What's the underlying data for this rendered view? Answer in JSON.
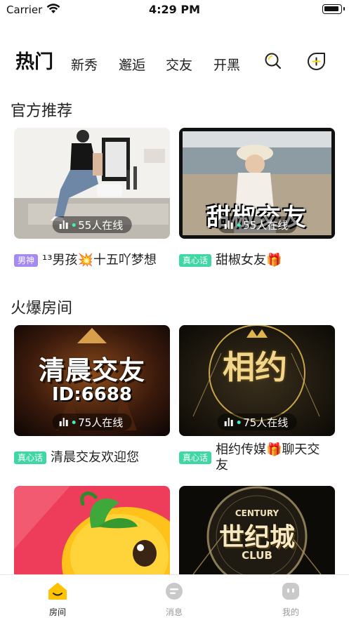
{
  "status_bar": {
    "carrier": "Carrier",
    "time": "4:29 PM"
  },
  "tabs": [
    {
      "label": "热门",
      "active": true
    },
    {
      "label": "新秀",
      "active": false
    },
    {
      "label": "邂逅",
      "active": false
    },
    {
      "label": "交友",
      "active": false
    },
    {
      "label": "开黑",
      "active": false
    }
  ],
  "header_icons": {
    "search": "search-icon",
    "create": "add-room-icon"
  },
  "sections": {
    "official": {
      "title": "官方推荐"
    },
    "hot": {
      "title": "火爆房间"
    }
  },
  "rooms": [
    {
      "online": "55人在线",
      "badge": "男神",
      "title": "¹³男孩💥十五吖梦想"
    },
    {
      "online": "55人在线",
      "badge": "真心话",
      "title": "甜椒女友🎁",
      "cover_text": "甜椒交友"
    },
    {
      "online": "75人在线",
      "badge": "真心话",
      "title": "清晨交友欢迎您",
      "cover_text": "清晨交友",
      "cover_sub": "ID:6688"
    },
    {
      "online": "75人在线",
      "badge": "真心话",
      "title": "相约传媒🎁聊天交友",
      "cover_text": "相约"
    },
    {
      "cover_text": ""
    },
    {
      "cover_text": "世纪城",
      "cover_sub": "CLUB",
      "cover_top": "CENTURY"
    }
  ],
  "bottom_nav": [
    {
      "label": "房间",
      "active": true,
      "icon": "home-icon"
    },
    {
      "label": "消息",
      "active": false,
      "icon": "message-icon"
    },
    {
      "label": "我的",
      "active": false,
      "icon": "profile-icon"
    }
  ],
  "colors": {
    "accent": "#ffd400",
    "badge_purple": "#a58bf0",
    "badge_green": "#3fd7a3"
  }
}
